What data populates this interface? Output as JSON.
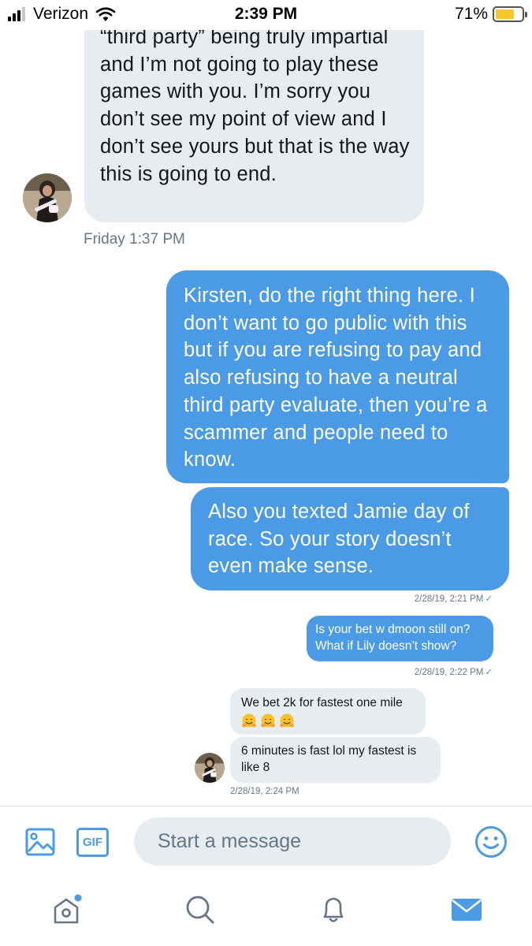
{
  "status_bar": {
    "carrier": "Verizon",
    "time": "2:39 PM",
    "battery_percent": "71%",
    "battery_level": 0.71,
    "signal_bars": 3
  },
  "thread": {
    "messages": [
      {
        "direction": "incoming",
        "text": "“third party” being truly impartial and I’m not going to play these games with you. I’m sorry you don’t see my point of view and I don’t see yours but that is the way this is going to end."
      },
      {
        "direction": "outgoing",
        "text": "Kirsten, do the right thing here. I don’t want to go public with this but if you are refusing to pay and also refusing to have a neutral third party evaluate, then you’re a scammer and people need to know."
      },
      {
        "direction": "outgoing",
        "text": "Also you texted Jamie day of race. So your story doesn’t even make sense."
      },
      {
        "direction": "outgoing",
        "text": "Is your bet w dmoon still on? What if Lily doesn’t show?"
      },
      {
        "direction": "incoming",
        "text": "We bet 2k for fastest one mile",
        "emoji_count": 3,
        "emoji_name": "hugging-face-emoji"
      },
      {
        "direction": "incoming",
        "text": "6 minutes is fast lol my fastest is like 8"
      }
    ],
    "timestamps": {
      "friday": "Friday 1:37 PM",
      "sent_1": "2/28/19, 2:21 PM",
      "sent_2": "2/28/19, 2:22 PM",
      "received_3": "2/28/19, 2:24 PM"
    },
    "read_check": "✓"
  },
  "composer": {
    "gif_label": "GIF",
    "placeholder": "Start a message"
  },
  "tab_bar": {
    "items": [
      "home-icon",
      "search-icon",
      "notifications-icon",
      "messages-icon"
    ],
    "home_has_dot": true
  },
  "colors": {
    "accent": "#4a9ae6",
    "incoming_bubble": "#e6ecf0",
    "meta_text": "#657786",
    "battery": "#f7c62a"
  }
}
